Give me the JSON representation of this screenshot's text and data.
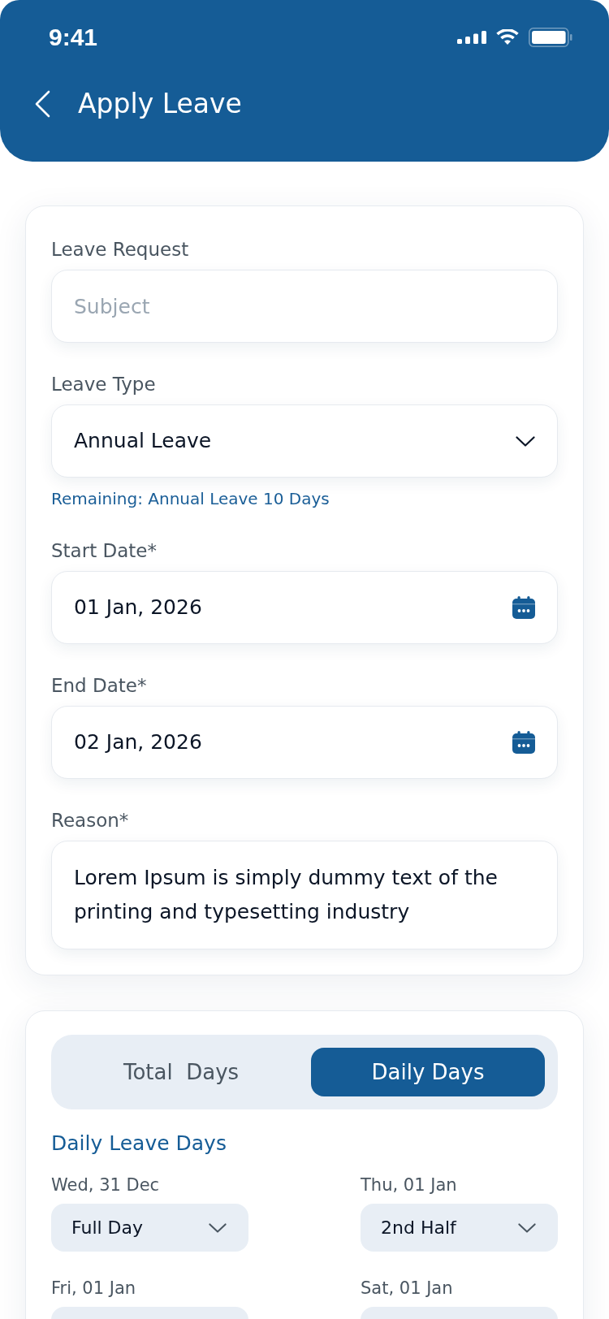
{
  "status_bar": {
    "time": "9:41"
  },
  "header": {
    "title": "Apply Leave"
  },
  "form": {
    "fields": [
      {
        "kind": "text",
        "label": "Leave Request",
        "placeholder": "Subject"
      },
      {
        "kind": "select",
        "label": "Leave Type",
        "value": "Annual Leave",
        "hint": "Remaining: Annual Leave 10 Days"
      },
      {
        "kind": "date",
        "label": "Start Date*",
        "value": "01 Jan, 2026"
      },
      {
        "kind": "date",
        "label": "End Date*",
        "value": "02 Jan, 2026"
      },
      {
        "kind": "textarea",
        "label": "Reason*",
        "value": "Lorem Ipsum is simply dummy text of the printing and typesetting industry"
      }
    ]
  },
  "days_card": {
    "tabs": [
      {
        "label": "Total  Days",
        "selected": false
      },
      {
        "label": "Daily Days",
        "selected": true
      }
    ],
    "section_title": "Daily Leave Days",
    "days": [
      {
        "date": "Wed, 31 Dec",
        "value": "Full Day"
      },
      {
        "date": "Thu, 01 Jan",
        "value": "2nd Half"
      },
      {
        "date": "Fri, 01 Jan"
      },
      {
        "date": "Sat, 01 Jan"
      }
    ]
  }
}
